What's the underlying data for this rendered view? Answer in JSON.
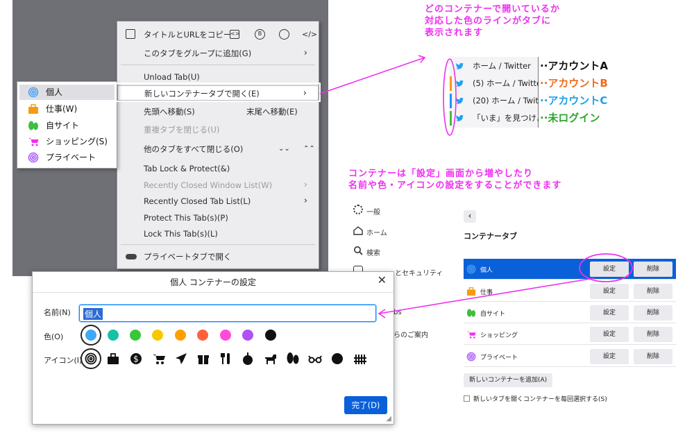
{
  "context_menu": {
    "top_icons": [
      "book-icon",
      "qr-icon",
      "b-icon",
      "globe-icon",
      "code-icon"
    ],
    "items": [
      {
        "label": "タイトルとURLをコピー",
        "disabled": false
      },
      {
        "label": "このタブをグループに追加(G)",
        "disabled": false,
        "arrow": "›"
      },
      {
        "label": "Unload Tab(U)",
        "disabled": false
      },
      {
        "label": "新しいコンテナータブで開く(E)",
        "disabled": false,
        "arrow": "›"
      },
      {
        "label": "先頭へ移動(S)",
        "right": "末尾へ移動(E)",
        "disabled": false
      },
      {
        "label": "重複タブを閉じる(U)",
        "disabled": true
      },
      {
        "label": "他のタブをすべて閉じる(O)",
        "disabled": false
      },
      {
        "label": "Tab Lock & Protect(&)",
        "disabled": false
      },
      {
        "label": "Recently Closed Window List(W)",
        "disabled": true,
        "arrow": "›"
      },
      {
        "label": "Recently Closed Tab List(L)",
        "disabled": false,
        "arrow": "›"
      },
      {
        "label": "Protect This Tab(s)(P)",
        "disabled": false
      },
      {
        "label": "Lock This Tab(s)(L)",
        "disabled": false
      },
      {
        "label": "プライベートタブで開く",
        "disabled": false
      }
    ]
  },
  "container_submenu": [
    {
      "label": "個人",
      "icon": "fingerprint-icon",
      "color": "#4a9ff5"
    },
    {
      "label": "仕事(W)",
      "icon": "briefcase-icon",
      "color": "#f39c12"
    },
    {
      "label": "自サイト",
      "icon": "tree-icon",
      "color": "#3fbf3f"
    },
    {
      "label": "ショッピング(S)",
      "icon": "cart-icon",
      "color": "#ef2ff0"
    },
    {
      "label": "プライベート",
      "icon": "fingerprint-icon",
      "color": "#a855f7"
    }
  ],
  "annotations": {
    "top": [
      "どのコンテナーで開いているか",
      "対応した色のラインがタブに",
      "表示されます"
    ],
    "middle": [
      "コンテナーは「設定」画面から増やしたり",
      "名前や色・アイコンの設定をすることができます"
    ]
  },
  "tab_example": [
    {
      "label": "ホーム / Twitter",
      "account": "··アカウントA",
      "line_color": "",
      "account_color": "#111111"
    },
    {
      "label": "(5) ホーム / Twitte",
      "account": "··アカウントB",
      "line_color": "#f39c12",
      "account_color": "#f26a1b"
    },
    {
      "label": "(20) ホーム / Twitt",
      "account": "··アカウントC",
      "line_color": "#1e90ff",
      "account_color": "#1aa0e8"
    },
    {
      "label": "「いま」を見つけよう",
      "account": "··未ログイン",
      "line_color": "#3fbf3f",
      "account_color": "#2ca82c"
    }
  ],
  "dialog": {
    "title": "個人 コンテナーの設定",
    "name_label": "名前(N)",
    "name_value": "個人",
    "color_label": "色(O)",
    "colors": [
      "#3fa9f5",
      "#16c1a4",
      "#37c837",
      "#f7c800",
      "#ff9f00",
      "#ff613d",
      "#ff4bda",
      "#af51f5",
      "#111111"
    ],
    "icon_label": "アイコン(I)",
    "icons": [
      "fingerprint-icon",
      "briefcase-icon",
      "dollar-icon",
      "cart-icon",
      "plane-icon",
      "gift-icon",
      "food-icon",
      "fruit-icon",
      "pet-icon",
      "tree-icon",
      "glasses-icon",
      "circle-icon",
      "fence-icon"
    ],
    "done_label": "完了(D)"
  },
  "settings": {
    "sidebar": [
      {
        "label": "一般",
        "icon": "gear-icon"
      },
      {
        "label": "ホーム",
        "icon": "home-icon"
      },
      {
        "label": "検索",
        "icon": "search-icon"
      },
      {
        "label": "とセキュリティ",
        "icon": "lock-icon"
      },
      {
        "label": "bs",
        "icon": ""
      },
      {
        "label": "らのご案内",
        "icon": ""
      }
    ],
    "back_icon": "back-arrow-icon",
    "heading": "コンテナータブ",
    "rows": [
      {
        "label": "個人",
        "icon": "fingerprint-icon",
        "color": "#4a9ff5",
        "selected": true
      },
      {
        "label": "仕事",
        "icon": "briefcase-icon",
        "color": "#f39c12",
        "selected": false
      },
      {
        "label": "自サイト",
        "icon": "tree-icon",
        "color": "#3fbf3f",
        "selected": false
      },
      {
        "label": "ショッピング",
        "icon": "cart-icon",
        "color": "#ef2ff0",
        "selected": false
      },
      {
        "label": "プライベート",
        "icon": "fingerprint-icon",
        "color": "#a855f7",
        "selected": false
      }
    ],
    "settings_button": "設定",
    "delete_button": "削除",
    "add_button": "新しいコンテナーを追加(A)",
    "checkbox_label": "新しいタブを開くコンテナーを毎回選択する(S)"
  }
}
